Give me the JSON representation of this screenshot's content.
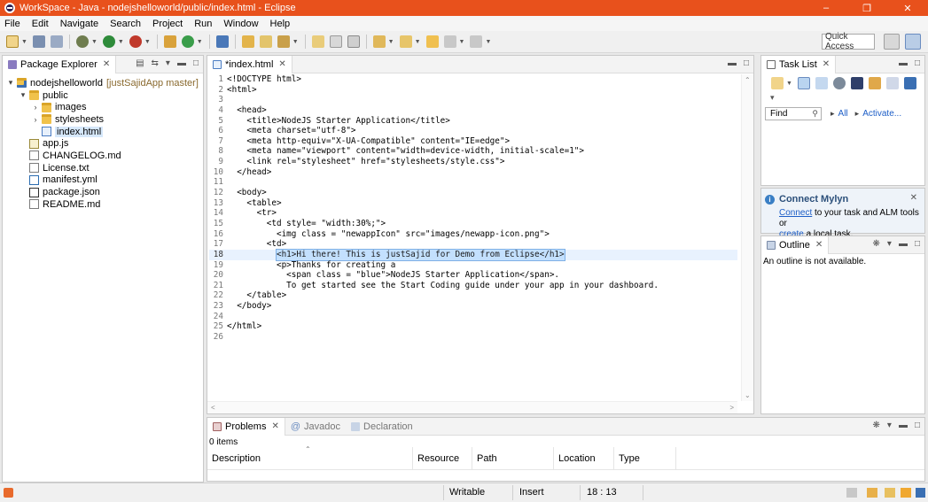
{
  "window": {
    "title": "WorkSpace - Java - nodejshelloworld/public/index.html - Eclipse"
  },
  "menu": [
    "File",
    "Edit",
    "Navigate",
    "Search",
    "Project",
    "Run",
    "Window",
    "Help"
  ],
  "toolbar": {
    "quick_access": "Quick Access"
  },
  "package_explorer": {
    "tab": "Package Explorer",
    "tree": [
      {
        "label": "nodejshelloworld",
        "extra": "[justSajidApp master]",
        "type": "proj",
        "depth": 0,
        "twisty": "▾"
      },
      {
        "label": "public",
        "type": "folder",
        "depth": 1,
        "twisty": "▾"
      },
      {
        "label": "images",
        "type": "folder",
        "depth": 2,
        "twisty": "›"
      },
      {
        "label": "stylesheets",
        "type": "folder",
        "depth": 2,
        "twisty": "›"
      },
      {
        "label": "index.html",
        "type": "html",
        "depth": 2,
        "twisty": "",
        "selected": true
      },
      {
        "label": "app.js",
        "type": "js",
        "depth": 1,
        "twisty": ""
      },
      {
        "label": "CHANGELOG.md",
        "type": "file",
        "depth": 1,
        "twisty": ""
      },
      {
        "label": "License.txt",
        "type": "file",
        "depth": 1,
        "twisty": ""
      },
      {
        "label": "manifest.yml",
        "type": "yml",
        "depth": 1,
        "twisty": ""
      },
      {
        "label": "package.json",
        "type": "json",
        "depth": 1,
        "twisty": ""
      },
      {
        "label": "README.md",
        "type": "file",
        "depth": 1,
        "twisty": ""
      }
    ]
  },
  "editor": {
    "tab": "*index.html",
    "lines": [
      "<!DOCTYPE html>",
      "<html>",
      "",
      "  <head>",
      "    <title>NodeJS Starter Application</title>",
      "    <meta charset=\"utf-8\">",
      "    <meta http-equiv=\"X-UA-Compatible\" content=\"IE=edge\">",
      "    <meta name=\"viewport\" content=\"width=device-width, initial-scale=1\">",
      "    <link rel=\"stylesheet\" href=\"stylesheets/style.css\">",
      "  </head>",
      "",
      "  <body>",
      "    <table>",
      "      <tr>",
      "        <td style= \"width:30%;\">",
      "          <img class = \"newappIcon\" src=\"images/newapp-icon.png\">",
      "        <td>",
      "          <h1>Hi there! This is justSajid for Demo from Eclipse</h1>",
      "          <p>Thanks for creating a",
      "            <span class = \"blue\">NodeJS Starter Application</span>.",
      "            To get started see the Start Coding guide under your app in your dashboard.",
      "    </table>",
      "  </body>",
      "",
      "</html>",
      ""
    ],
    "current_line": 18,
    "indent_18": "          ",
    "selected_18": "<h1>Hi there! This is justSajid for Demo from Eclipse</h1>"
  },
  "task_list": {
    "tab": "Task List",
    "find_placeholder": "Find",
    "all": "All",
    "activate": "Activate..."
  },
  "mylyn": {
    "title": "Connect Mylyn",
    "connect": "Connect",
    "text1": " to your task and ALM tools or",
    "create": "create",
    "text2": " a local task."
  },
  "outline": {
    "tab": "Outline",
    "message": "An outline is not available."
  },
  "bottom": {
    "tabs": [
      "Problems",
      "Javadoc",
      "Declaration"
    ],
    "count": "0 items",
    "columns": [
      "Description",
      "Resource",
      "Path",
      "Location",
      "Type"
    ]
  },
  "status": {
    "writable": "Writable",
    "insert": "Insert",
    "position": "18 : 13"
  }
}
